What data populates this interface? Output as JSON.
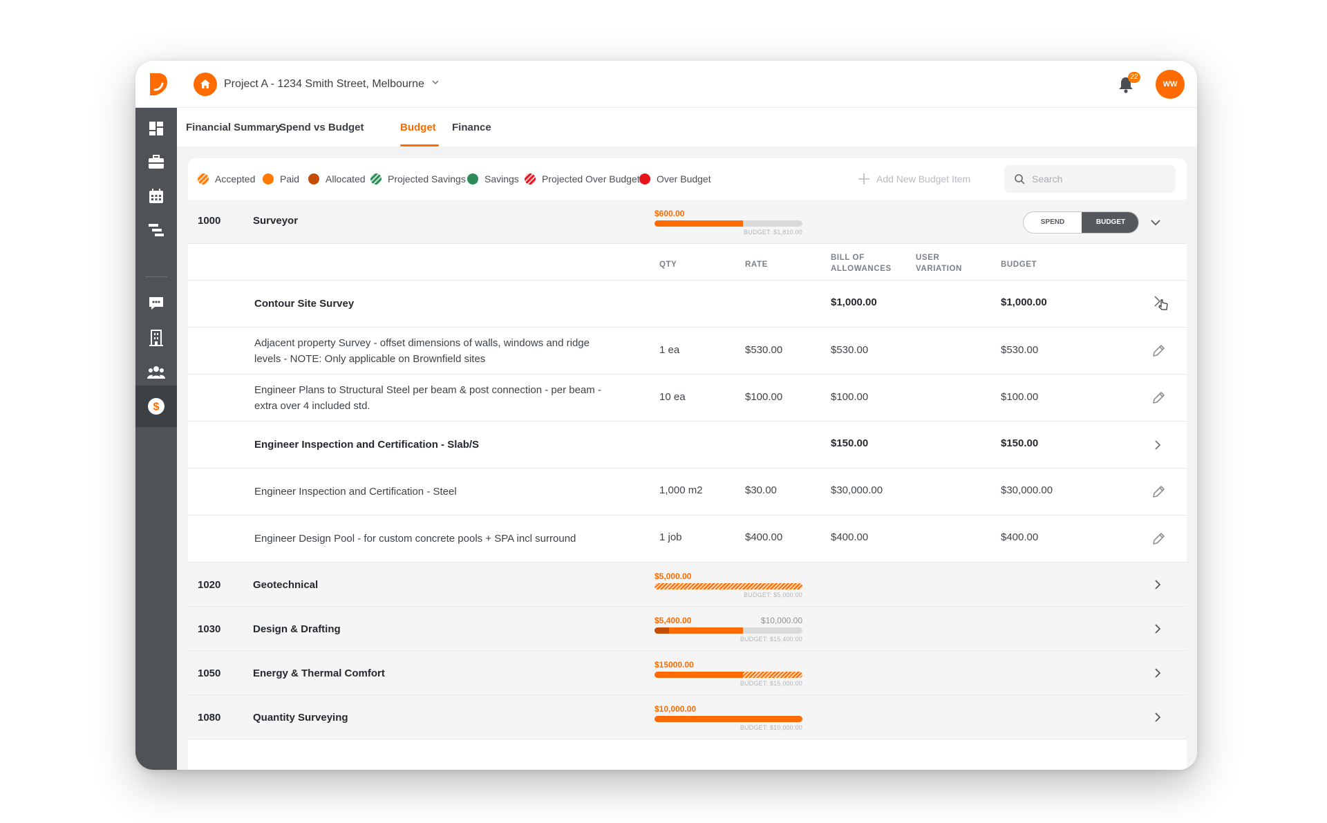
{
  "header": {
    "project_name": "Project A - 1234 Smith Street, Melbourne",
    "notification_count": "22",
    "avatar_initials": "WW"
  },
  "colors": {
    "brand": "#ff6b00",
    "sidebar": "#4f5257",
    "savings": "#2e8b57",
    "over_budget": "#e8141c",
    "allocated": "#c44e00"
  },
  "sidebar": {
    "items": [
      {
        "icon": "dashboard-icon"
      },
      {
        "icon": "briefcase-icon"
      },
      {
        "icon": "calendar-icon"
      },
      {
        "icon": "gantt-icon"
      },
      {
        "icon": "chat-icon"
      },
      {
        "icon": "building-icon"
      },
      {
        "icon": "team-icon"
      },
      {
        "icon": "dollar-icon",
        "active": true
      }
    ]
  },
  "tabs": [
    {
      "label": "Financial Summary"
    },
    {
      "label": "Spend vs Budget"
    },
    {
      "label": "Budget",
      "active": true
    },
    {
      "label": "Finance"
    }
  ],
  "legend": [
    {
      "label": "Accepted",
      "style": "hatch-orange"
    },
    {
      "label": "Paid",
      "color": "#ff7a00"
    },
    {
      "label": "Allocated",
      "color": "#c44e00"
    },
    {
      "label": "Projected Savings",
      "style": "hatch-green"
    },
    {
      "label": "Savings",
      "color": "#2e8b57"
    },
    {
      "label": "Projected Over Budget",
      "style": "hatch-red"
    },
    {
      "label": "Over Budget",
      "color": "#e8141c"
    }
  ],
  "add_item_label": "Add New Budget Item",
  "search": {
    "placeholder": "Search"
  },
  "expanded_category": {
    "code": "1000",
    "name": "Surveyor",
    "amount": "$600.00",
    "budget_label": "BUDGET: $1,810.00",
    "progress": 0.6,
    "toggle": {
      "spend": "SPEND",
      "budget": "BUDGET",
      "selected": "BUDGET"
    }
  },
  "columns": {
    "qty": "QTY",
    "rate": "RATE",
    "bill_line1": "BILL OF",
    "bill_line2": "ALLOWANCES",
    "user_line1": "USER",
    "user_line2": "VARIATION",
    "budget": "BUDGET"
  },
  "items": [
    {
      "desc": "Contour Site Survey",
      "qty": "",
      "rate": "",
      "bill": "$1,000.00",
      "budget": "$1,000.00",
      "group": true
    },
    {
      "desc": "Adjacent property Survey - offset dimensions of walls, windows and ridge levels - NOTE: Only applicable on Brownfield sites",
      "qty": "1 ea",
      "rate": "$530.00",
      "bill": "$530.00",
      "budget": "$530.00",
      "group": false
    },
    {
      "desc": "Engineer Plans to Structural Steel per beam & post connection - per beam - extra over 4 included std.",
      "qty": "10 ea",
      "rate": "$100.00",
      "bill": "$100.00",
      "budget": "$100.00",
      "group": false
    },
    {
      "desc": "Engineer Inspection and Certification - Slab/S",
      "qty": "",
      "rate": "",
      "bill": "$150.00",
      "budget": "$150.00",
      "group": true
    },
    {
      "desc": "Engineer Inspection and Certification - Steel",
      "qty": "1,000 m2",
      "rate": "$30.00",
      "bill": "$30,000.00",
      "budget": "$30,000.00",
      "group": false
    },
    {
      "desc": "Engineer Design Pool - for custom concrete pools + SPA incl surround",
      "qty": "1 job",
      "rate": "$400.00",
      "bill": "$400.00",
      "budget": "$400.00",
      "group": false
    }
  ],
  "categories": [
    {
      "code": "1020",
      "name": "Geotechnical",
      "amount": "$5,000.00",
      "right": "",
      "budget_label": "BUDGET: $5,000.00",
      "accepted": 1.0,
      "paid": 0.0,
      "allocated": 0.0
    },
    {
      "code": "1030",
      "name": "Design & Drafting",
      "amount": "$5,400.00",
      "right": "$10,000.00",
      "budget_label": "BUDGET: $15,400.00",
      "accepted": 0.0,
      "paid": 0.6,
      "allocated": 0.1
    },
    {
      "code": "1050",
      "name": "Energy & Thermal Comfort",
      "amount": "$15000.00",
      "right": "",
      "budget_label": "BUDGET: $15,000.00",
      "accepted": 0.4,
      "paid": 0.6,
      "allocated": 0.0
    },
    {
      "code": "1080",
      "name": "Quantity Surveying",
      "amount": "$10,000.00",
      "right": "",
      "budget_label": "BUDGET: $10,000.00",
      "accepted": 0.0,
      "paid": 1.0,
      "allocated": 0.0
    }
  ]
}
